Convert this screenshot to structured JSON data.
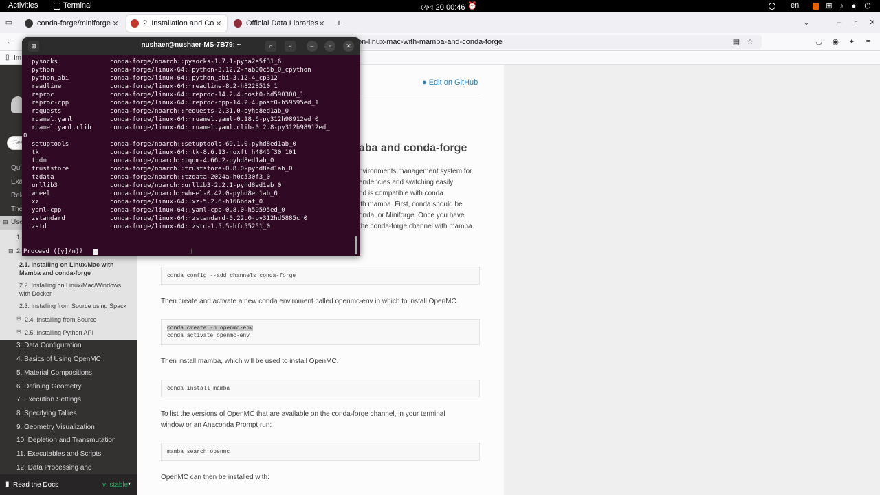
{
  "topbar": {
    "activities": "Activities",
    "app_name": "Terminal",
    "clock": "ফেব 20  00:46",
    "lang": "en"
  },
  "browser": {
    "tabs": [
      {
        "title": "conda-forge/miniforge: ",
        "active": false,
        "favicon": "github-icon"
      },
      {
        "title": "2. Installation and Confi",
        "active": true,
        "favicon": "openmc-icon"
      },
      {
        "title": "Official Data Libraries | O",
        "active": false,
        "favicon": "openmc-icon"
      }
    ],
    "url_visible": "on-linux-mac-with-mamba-and-conda-forge"
  },
  "sidebar": {
    "partial_items": [
      "Im",
      "Quic",
      "Exar",
      "Rele",
      "Theo",
      "Use",
      "1.",
      "2."
    ],
    "search_partial": "Sea",
    "sub_items": [
      "2.1. Installing on Linux/Mac with Mamba and conda-forge",
      "2.2. Installing on Linux/Mac/Windows with Docker",
      "2.3. Installing from Source using Spack",
      "2.4. Installing from Source",
      "2.5. Installing Python API"
    ],
    "toc": [
      "3. Data Configuration",
      "4. Basics of Using OpenMC",
      "5. Material Compositions",
      "6. Defining Geometry",
      "7. Execution Settings",
      "8. Specifying Tallies",
      "9. Geometry Visualization",
      "10. Depletion and Transmutation",
      "11. Executables and Scripts",
      "12. Data Processing and"
    ],
    "rtd_label": "Read the Docs",
    "version_label": "v: stable"
  },
  "content": {
    "edit_github": "Edit on GitHub",
    "heading_partial": "aba and conda-forge",
    "intro_lines": [
      "nvironments management system for",
      "endencies and switching easily",
      "nd is compatible with conda",
      "ith mamba. First, conda should be",
      "onda, or Miniforge. Once you have",
      "the conda-forge channel with mamba."
    ],
    "code1": "conda config --add channels conda-forge",
    "para2": "Then create and activate a new conda enviroment called openmc-env in which to install OpenMC.",
    "code2_line1": "conda create -n openmc-env",
    "code2_line2": "conda activate openmc-env",
    "para3": "Then install mamba, which will be used to install OpenMC.",
    "code3": "conda install mamba",
    "para4_line1": "To list the versions of OpenMC that are available on the conda-forge channel, in your terminal",
    "para4_line2": "window or an Anaconda Prompt run:",
    "code4": "mamba search openmc",
    "para5": "OpenMC can then be installed with:"
  },
  "terminal": {
    "title": "nushaer@nushaer-MS-7B79: ~",
    "lines": [
      {
        "name": "pysocks",
        "spec": "conda-forge/noarch::pysocks-1.7.1-pyha2e5f31_6"
      },
      {
        "name": "python",
        "spec": "conda-forge/linux-64::python-3.12.2-hab00c5b_0_cpython"
      },
      {
        "name": "python_abi",
        "spec": "conda-forge/linux-64::python_abi-3.12-4_cp312"
      },
      {
        "name": "readline",
        "spec": "conda-forge/linux-64::readline-8.2-h8228510_1"
      },
      {
        "name": "reproc",
        "spec": "conda-forge/linux-64::reproc-14.2.4.post0-hd590300_1"
      },
      {
        "name": "reproc-cpp",
        "spec": "conda-forge/linux-64::reproc-cpp-14.2.4.post0-h59595ed_1"
      },
      {
        "name": "requests",
        "spec": "conda-forge/noarch::requests-2.31.0-pyhd8ed1ab_0"
      },
      {
        "name": "ruamel.yaml",
        "spec": "conda-forge/linux-64::ruamel.yaml-0.18.6-py312h98912ed_0"
      },
      {
        "name": "ruamel.yaml.clib",
        "spec": "conda-forge/linux-64::ruamel.yaml.clib-0.2.8-py312h98912ed_"
      },
      {
        "name": "setuptools",
        "spec": "conda-forge/noarch::setuptools-69.1.0-pyhd8ed1ab_0"
      },
      {
        "name": "tk",
        "spec": "conda-forge/linux-64::tk-8.6.13-noxft_h4845f30_101"
      },
      {
        "name": "tqdm",
        "spec": "conda-forge/noarch::tqdm-4.66.2-pyhd8ed1ab_0"
      },
      {
        "name": "truststore",
        "spec": "conda-forge/noarch::truststore-0.8.0-pyhd8ed1ab_0"
      },
      {
        "name": "tzdata",
        "spec": "conda-forge/noarch::tzdata-2024a-h0c530f3_0"
      },
      {
        "name": "urllib3",
        "spec": "conda-forge/noarch::urllib3-2.2.1-pyhd8ed1ab_0"
      },
      {
        "name": "wheel",
        "spec": "conda-forge/noarch::wheel-0.42.0-pyhd8ed1ab_0"
      },
      {
        "name": "xz",
        "spec": "conda-forge/linux-64::xz-5.2.6-h166bdaf_0"
      },
      {
        "name": "yaml-cpp",
        "spec": "conda-forge/linux-64::yaml-cpp-0.8.0-h59595ed_0"
      },
      {
        "name": "zstandard",
        "spec": "conda-forge/linux-64::zstandard-0.22.0-py312hd5885c_0"
      },
      {
        "name": "zstd",
        "spec": "conda-forge/linux-64::zstd-1.5.5-hfc55251_0"
      }
    ],
    "wrap_char": "0",
    "prompt": "Proceed ([y]/n)?"
  },
  "colors": {
    "terminal_bg": "#300a24",
    "link": "#2980b9",
    "visited_link": "#9b59b6",
    "sidebar_bg": "#343131",
    "rtd_version": "#27ae60"
  }
}
